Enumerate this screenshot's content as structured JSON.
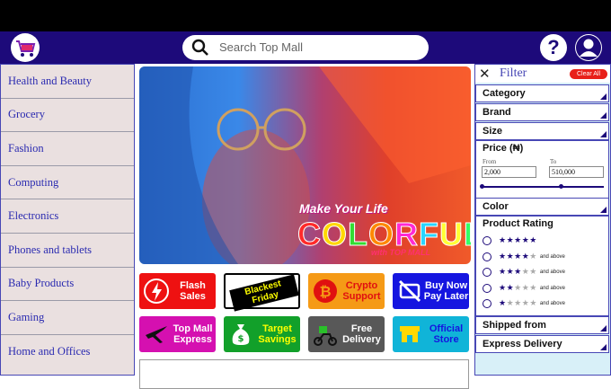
{
  "header": {
    "search_placeholder": "Search Top Mall",
    "help_glyph": "?",
    "logo_icon": "cart-icon",
    "colors": {
      "bar": "#1d0a7a",
      "top": "#000000"
    }
  },
  "sidebar": {
    "items": [
      {
        "label": "Health and Beauty"
      },
      {
        "label": "Grocery"
      },
      {
        "label": "Fashion"
      },
      {
        "label": "Computing"
      },
      {
        "label": "Electronics"
      },
      {
        "label": "Phones and tablets"
      },
      {
        "label": "Baby Products"
      },
      {
        "label": "Gaming"
      },
      {
        "label": "Home and Offices"
      }
    ]
  },
  "hero": {
    "line1": "Make Your Life",
    "line2_letters": [
      "C",
      "O",
      "L",
      "O",
      "R",
      "F",
      "U",
      "L"
    ],
    "letter_colors": [
      "#ff2a2a",
      "#ffd800",
      "#33dd33",
      "#ff8800",
      "#ff2ad4",
      "#2ad4ff",
      "#ffff33",
      "#33ff66"
    ],
    "line3": "with TOP MALL"
  },
  "tiles": [
    {
      "label_lines": [
        "Flash",
        "Sales"
      ],
      "icon": "lightning-icon",
      "bg": "#ee1111",
      "fg": "#ffffff"
    },
    {
      "label_lines": [
        "Blackest",
        "Friday"
      ],
      "icon": "",
      "bg": "#ffffff",
      "fg": "#ffff00"
    },
    {
      "label_lines": [
        "Crypto",
        "Support"
      ],
      "icon": "bitcoin-icon",
      "bg": "#f59a16",
      "fg": "#e01010"
    },
    {
      "label_lines": [
        "Buy Now",
        "Pay Later"
      ],
      "icon": "no-card-icon",
      "bg": "#1515e0",
      "fg": "#ffffff"
    },
    {
      "label_lines": [
        "Top Mall",
        "Express"
      ],
      "icon": "airplane-icon",
      "bg": "#d510b0",
      "fg": "#ffffff"
    },
    {
      "label_lines": [
        "Target",
        "Savings"
      ],
      "icon": "money-bag-icon",
      "bg": "#12a02a",
      "fg": "#ffff00"
    },
    {
      "label_lines": [
        "Free",
        "Delivery"
      ],
      "icon": "delivery-bike-icon",
      "bg": "#585858",
      "fg": "#ffffff"
    },
    {
      "label_lines": [
        "Official",
        "Store"
      ],
      "icon": "store-icon",
      "bg": "#10b4d8",
      "fg": "#1515e0"
    }
  ],
  "filter": {
    "close_glyph": "✕",
    "title": "Filter",
    "clear_label": "Clear All",
    "sections_top": [
      "Category",
      "Brand",
      "Size"
    ],
    "price": {
      "label": "Price (₦)",
      "from_label": "From",
      "to_label": "To",
      "from_value": "2,000",
      "to_value": "510,000",
      "slider_low": 0.0,
      "slider_high": 0.65
    },
    "color_label": "Color",
    "rating": {
      "label": "Product Rating",
      "rows": [
        {
          "stars": 5,
          "suffix": ""
        },
        {
          "stars": 4,
          "suffix": "and above"
        },
        {
          "stars": 3,
          "suffix": "and above"
        },
        {
          "stars": 2,
          "suffix": "and above"
        },
        {
          "stars": 1,
          "suffix": "and above"
        }
      ]
    },
    "sections_bottom": [
      "Shipped from",
      "Express Delivery"
    ]
  }
}
